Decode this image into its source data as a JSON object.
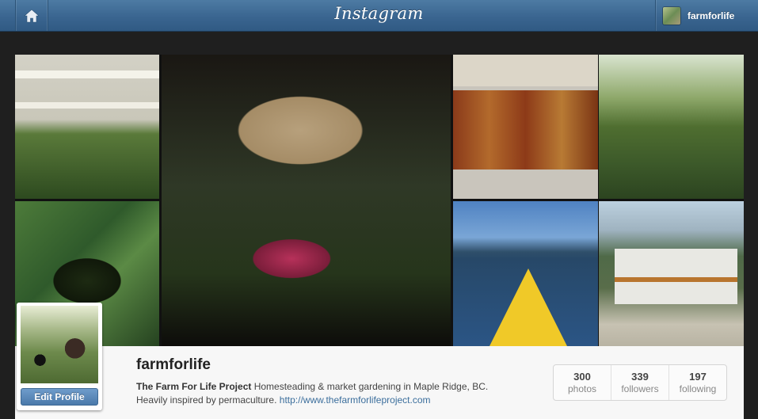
{
  "header": {
    "logo_text": "Instagram",
    "home_icon": "home-icon",
    "user_name": "farmforlife"
  },
  "photo_grid": {
    "photos": [
      {
        "subject": "chickens"
      },
      {
        "subject": "mason-jar-with-flowers"
      },
      {
        "subject": "mason-jars-of-honey"
      },
      {
        "subject": "watering-garden"
      },
      {
        "subject": "dill-and-leaves"
      },
      {
        "subject": "kayak-on-lake"
      },
      {
        "subject": "old-rv-camper"
      }
    ]
  },
  "profile": {
    "edit_button_label": "Edit Profile",
    "username": "farmforlife",
    "full_name": "The Farm For Life Project",
    "bio_text": "Homesteading & market gardening in Maple Ridge, BC.",
    "bio_line2": "Heavily inspired by permaculture.",
    "website": "http://www.thefarmforlifeproject.com",
    "stats": [
      {
        "count": "300",
        "label": "photos"
      },
      {
        "count": "339",
        "label": "followers"
      },
      {
        "count": "197",
        "label": "following"
      }
    ]
  },
  "colors": {
    "header_blue": "#3a6590",
    "link_blue": "#3b6e9c",
    "page_bg": "#1f1f1f"
  }
}
